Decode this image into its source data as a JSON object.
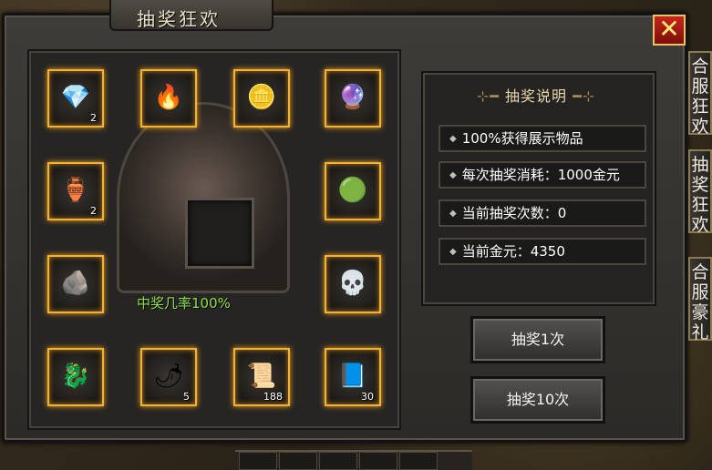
{
  "window": {
    "title": "抽奖狂欢",
    "close_label": "✕"
  },
  "prize_grid": {
    "slots": [
      {
        "icon": "blue-crystal-icon",
        "glyph": "💎",
        "count": "2"
      },
      {
        "icon": "fire-ring-icon",
        "glyph": "🔥",
        "count": ""
      },
      {
        "icon": "gold-pile-icon",
        "glyph": "🪙",
        "count": ""
      },
      {
        "icon": "spirit-orb-icon",
        "glyph": "🔮",
        "count": ""
      },
      {
        "icon": "pot-icon",
        "glyph": "🏺",
        "count": "2"
      },
      {
        "icon": "green-gem-icon",
        "glyph": "🟢",
        "count": ""
      },
      {
        "icon": "stone-tablet-icon",
        "glyph": "🪨",
        "count": ""
      },
      {
        "icon": "skull-icon",
        "glyph": "💀",
        "count": ""
      },
      {
        "icon": "dragon-icon",
        "glyph": "🐉",
        "count": ""
      },
      {
        "icon": "herb-icon",
        "glyph": "🌶",
        "count": "5"
      },
      {
        "icon": "scroll-red-icon",
        "glyph": "📜",
        "count": "188"
      },
      {
        "icon": "scroll-blue-icon",
        "glyph": "📘",
        "count": "30"
      }
    ]
  },
  "altar": {
    "odds_text": "中奖几率100%"
  },
  "info": {
    "heading": "抽奖说明",
    "rows": [
      "100%获得展示物品",
      "每次抽奖消耗：1000金元",
      "当前抽奖次数：0",
      "当前金元：4350"
    ]
  },
  "actions": {
    "draw_once": "抽奖1次",
    "draw_ten": "抽奖10次"
  },
  "side_tabs": [
    "合服狂欢",
    "抽奖狂欢",
    "合服豪礼"
  ]
}
